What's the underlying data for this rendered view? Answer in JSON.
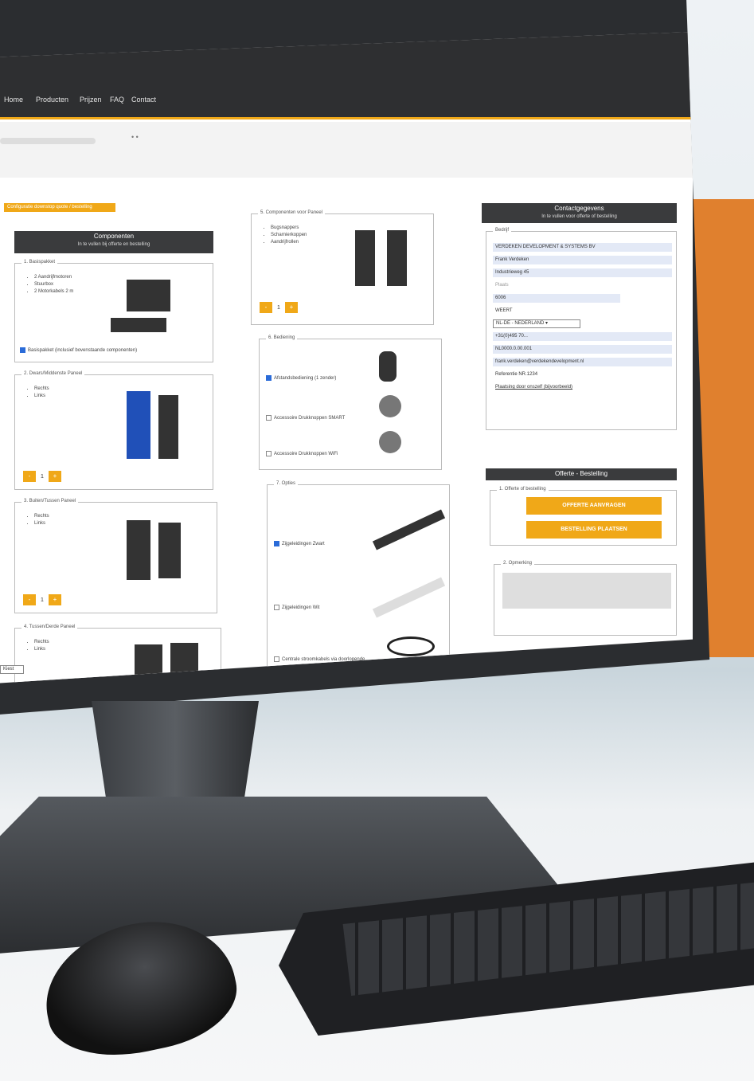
{
  "nav": [
    "Home",
    "Producten",
    "Prijzen",
    "FAQ",
    "Contact"
  ],
  "tag": "Configuratie downstop quote / bestelling",
  "components_header": {
    "title": "Componenten",
    "subtitle": "In te vullen bij offerte en bestelling"
  },
  "p1": {
    "title": "1. Basispakket",
    "items": [
      "2 Aandrijfmotoren",
      "Stuurbox",
      "2 Motorkabels 2 m"
    ],
    "check": "Basispakket (inclusief bovenstaande componenten)"
  },
  "p2": {
    "title": "2. Dwars/Middenste Paneel",
    "items": [
      "Rechts",
      "Links"
    ],
    "qty": "1"
  },
  "p3": {
    "title": "3. Buiten/Tussen Paneel",
    "items": [
      "Rechts",
      "Links"
    ],
    "qty": "1"
  },
  "p4": {
    "title": "4. Tussen/Derde Paneel",
    "items": [
      "Rechts",
      "Links"
    ]
  },
  "p5": {
    "title": "5. Componenten voor Paneel",
    "items": [
      "Bugsnappers",
      "Scharnierkoppen",
      "Aandrijfrollen"
    ],
    "qty": "1"
  },
  "p6": {
    "title": "6. Bediening",
    "opts": [
      "Afstandsbediening (1 zender)",
      "Accessoire Drukknoppen SMART",
      "Accessoire Drukknoppen WiFi"
    ]
  },
  "p7": {
    "title": "7. Opties",
    "opts": [
      "Zijgeleidingen Zwart",
      "Zijgeleidingen Wit",
      "Centrale stroomkabels via doorlopende"
    ]
  },
  "contact": {
    "title": "Contactgegevens",
    "subtitle": "In te vullen voor offerte of bestelling",
    "section": "Bedrijf",
    "company": "VERDEKEN DEVELOPMENT & SYSTEMS BV",
    "name": "Frank Verdeken",
    "street": "Industrieweg 45",
    "label_city": "Plaats",
    "zip": "6006",
    "city": "WEERT",
    "country": "NL-DE - NEDERLAND",
    "phone": "+31(0)495 70...",
    "vat": "NL0000.0.00.001",
    "email": "frank.verdeken@verdekendevelopment.nl",
    "ref": "Referentie NR.1234",
    "note": "Plaatsing door onszelf (bijvoorbeeld)"
  },
  "order": {
    "title": "Offerte - Bestelling",
    "section": "1. Offerte of bestelling",
    "btn_quote": "OFFERTE AANVRAGEN",
    "btn_order": "BESTELLING PLAATSEN",
    "section2": "2. Opmerking"
  },
  "dropdown_left": "Kiest"
}
